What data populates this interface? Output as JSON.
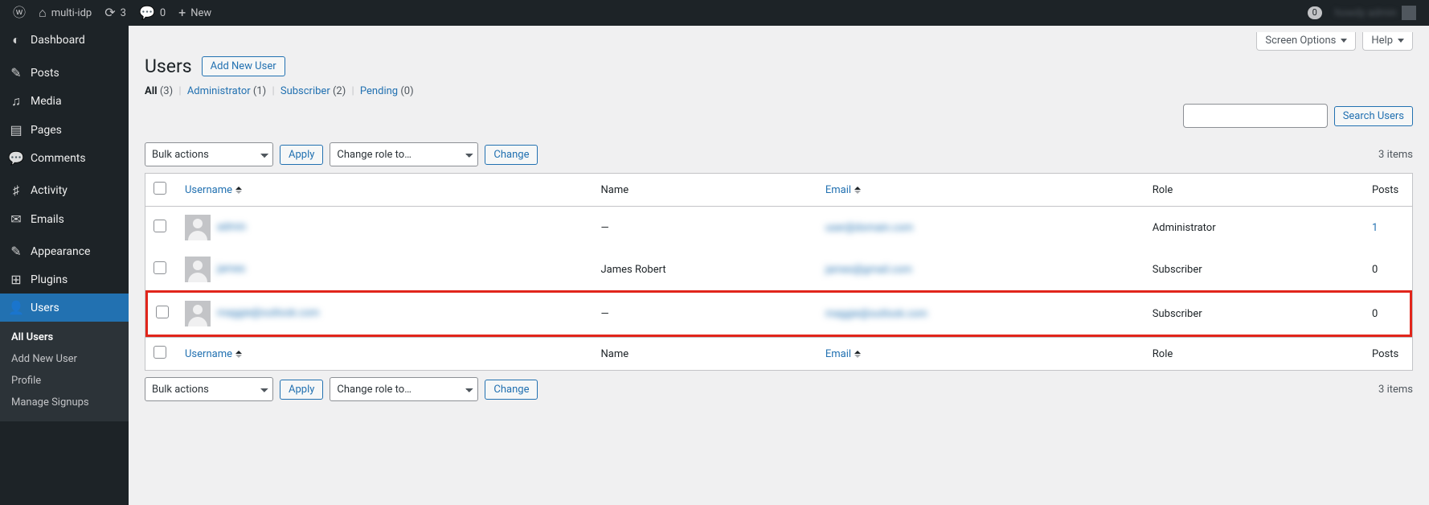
{
  "admin_bar": {
    "site_name": "multi-idp",
    "updates_count": "3",
    "comments_count": "0",
    "new_label": "New",
    "notifications_count": "0",
    "user_blur": "howdy admin"
  },
  "sidebar": {
    "items": [
      {
        "icon": "◐",
        "label": "Dashboard"
      },
      {
        "icon": "✎",
        "label": "Posts"
      },
      {
        "icon": "♫",
        "label": "Media"
      },
      {
        "icon": "▤",
        "label": "Pages"
      },
      {
        "icon": "💬",
        "label": "Comments"
      },
      {
        "icon": "♯",
        "label": "Activity"
      },
      {
        "icon": "✉",
        "label": "Emails"
      },
      {
        "icon": "✎",
        "label": "Appearance"
      },
      {
        "icon": "⊞",
        "label": "Plugins"
      },
      {
        "icon": "👤",
        "label": "Users"
      }
    ],
    "submenu": [
      "All Users",
      "Add New User",
      "Profile",
      "Manage Signups"
    ]
  },
  "header": {
    "title": "Users",
    "add_new": "Add New User",
    "screen_options": "Screen Options",
    "help": "Help"
  },
  "filters": {
    "all_label": "All",
    "all_count": "(3)",
    "administrator_label": "Administrator",
    "administrator_count": "(1)",
    "subscriber_label": "Subscriber",
    "subscriber_count": "(2)",
    "pending_label": "Pending",
    "pending_count": "(0)"
  },
  "search": {
    "button": "Search Users"
  },
  "tablenav": {
    "bulk_actions": "Bulk actions",
    "apply": "Apply",
    "change_role": "Change role to…",
    "change": "Change",
    "items_text": "3 items"
  },
  "columns": {
    "username": "Username",
    "name": "Name",
    "email": "Email",
    "role": "Role",
    "posts": "Posts"
  },
  "rows": [
    {
      "username_blur": "admin",
      "name": "—",
      "email_blur": "user@domain.com",
      "role": "Administrator",
      "posts": "1",
      "posts_link": true,
      "highlight": false
    },
    {
      "username_blur": "james",
      "name": "James Robert",
      "email_blur": "james@gmail.com",
      "role": "Subscriber",
      "posts": "0",
      "posts_link": false,
      "highlight": false
    },
    {
      "username_blur": "maggie@outlook.com",
      "name": "—",
      "email_blur": "maggie@outlook.com",
      "role": "Subscriber",
      "posts": "0",
      "posts_link": false,
      "highlight": true
    }
  ]
}
